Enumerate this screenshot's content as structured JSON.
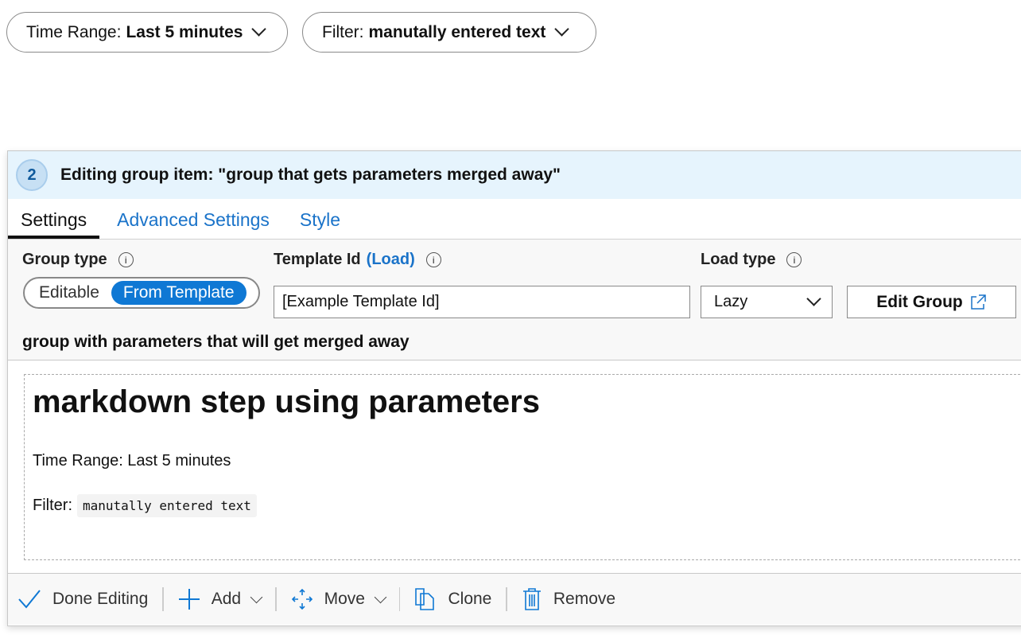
{
  "params": {
    "time_range": {
      "label": "Time Range:",
      "value": "Last 5 minutes"
    },
    "filter": {
      "label": "Filter:",
      "value": "manutally entered text"
    }
  },
  "editor": {
    "step_number": "2",
    "title": "Editing group item: \"group that gets parameters merged away\"",
    "tabs": [
      {
        "label": "Settings",
        "active": true
      },
      {
        "label": "Advanced Settings"
      },
      {
        "label": "Style"
      }
    ],
    "group_type": {
      "label": "Group type",
      "options": [
        "Editable",
        "From Template"
      ],
      "selected": "From Template"
    },
    "template_id": {
      "label": "Template Id",
      "load_link": "(Load)",
      "value": "[Example Template Id]"
    },
    "load_type": {
      "label": "Load type",
      "value": "Lazy"
    },
    "edit_group_label": "Edit Group",
    "group_title": "group with parameters that will get merged away"
  },
  "markdown": {
    "heading": "markdown step using parameters",
    "time_range_line": "Time Range: Last 5 minutes",
    "filter_label": "Filter:",
    "filter_value": "manutally entered text"
  },
  "toolbar": {
    "done": "Done Editing",
    "add": "Add",
    "move": "Move",
    "clone": "Clone",
    "remove": "Remove"
  },
  "colors": {
    "accent": "#0f78d4",
    "header_bg": "#e6f4fd"
  }
}
